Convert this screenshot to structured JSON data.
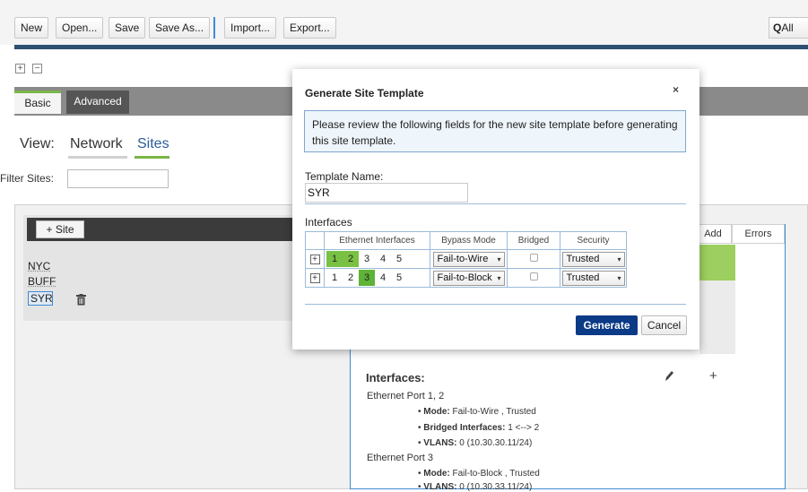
{
  "toolbar": {
    "new": "New",
    "open": "Open...",
    "save": "Save",
    "save_as": "Save As...",
    "import": "Import...",
    "export": "Export...",
    "filter_all": "All"
  },
  "tabs": {
    "basic": "Basic",
    "advanced": "Advanced"
  },
  "view": {
    "label": "View:",
    "network": "Network",
    "sites": "Sites"
  },
  "filter": {
    "label": "Filter Sites:",
    "value": ""
  },
  "sites": {
    "add_button": "Site",
    "items": [
      "NYC",
      "BUFF",
      "SYR"
    ]
  },
  "detail": {
    "col_add": "Add",
    "col_errors": "Errors",
    "interfaces_heading": "Interfaces:",
    "ports": [
      {
        "title": "Ethernet Port 1, 2",
        "bullets": [
          {
            "key": "Mode:",
            "val": "Fail-to-Wire , Trusted"
          },
          {
            "key": "Bridged Interfaces:",
            "val": "1 <--> 2"
          },
          {
            "key": "VLANS:",
            "val": "0 (10.30.30.11/24)"
          }
        ]
      },
      {
        "title": "Ethernet Port 3",
        "bullets": [
          {
            "key": "Mode:",
            "val": "Fail-to-Block , Trusted"
          },
          {
            "key": "VLANS:",
            "val": "0 (10.30.33.11/24)"
          }
        ]
      }
    ]
  },
  "modal": {
    "title": "Generate Site Template",
    "close": "×",
    "info": "Please review the following fields for the new site template before generating this site template.",
    "template_name_label": "Template Name:",
    "template_name_value": "SYR",
    "interfaces_label": "Interfaces",
    "table": {
      "headers": [
        "Ethernet Interfaces",
        "Bypass Mode",
        "Bridged",
        "Security"
      ],
      "rows": [
        {
          "ports": [
            "1",
            "2",
            "3",
            "4",
            "5"
          ],
          "highlight": [
            1,
            2
          ],
          "bypass": "Fail-to-Wire",
          "bridged": false,
          "security": "Trusted"
        },
        {
          "ports": [
            "1",
            "2",
            "3",
            "4",
            "5"
          ],
          "highlight": [
            3
          ],
          "bypass": "Fail-to-Block",
          "bridged": false,
          "security": "Trusted"
        }
      ]
    },
    "generate": "Generate",
    "cancel": "Cancel"
  },
  "colors": {
    "accent": "#0b3a86",
    "green": "#7ac143",
    "border_blue": "#9abbd9"
  }
}
